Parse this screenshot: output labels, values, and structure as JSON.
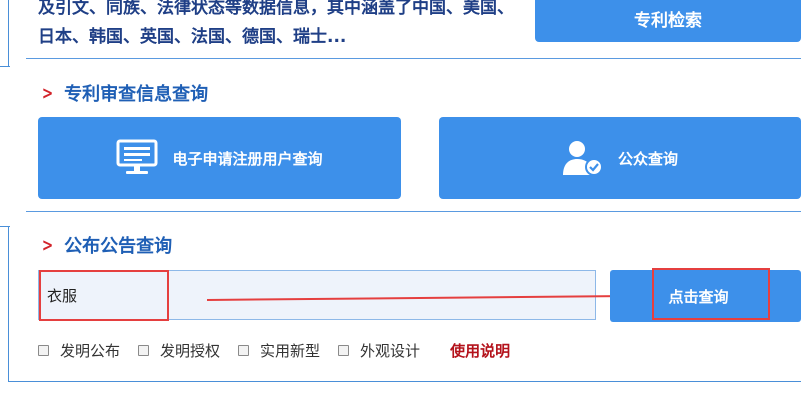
{
  "top": {
    "description": "及引文、同族、法律状态等数据信息，其中涵盖了中国、美国、日本、韩国、英国、法国、德国、瑞士...",
    "search_button_label": "专利检索"
  },
  "review_section": {
    "title": "专利审查信息查询",
    "tiles": [
      {
        "label": "电子申请注册用户查询",
        "icon": "monitor-icon"
      },
      {
        "label": "公众查询",
        "icon": "user-check-icon"
      }
    ]
  },
  "announcement_section": {
    "title": "公布公告查询",
    "search_value": "衣服",
    "query_button_label": "点击查询",
    "checkboxes": [
      {
        "label": "发明公布",
        "checked": false
      },
      {
        "label": "发明授权",
        "checked": false
      },
      {
        "label": "实用新型",
        "checked": false
      },
      {
        "label": "外观设计",
        "checked": false
      }
    ],
    "usage_link_label": "使用说明"
  },
  "colors": {
    "tile_blue": "#3d90ea",
    "heading_blue": "#1f5fb5",
    "chevron_red": "#d2232a",
    "highlight_red": "#e53f3f",
    "link_red": "#b4121b"
  }
}
